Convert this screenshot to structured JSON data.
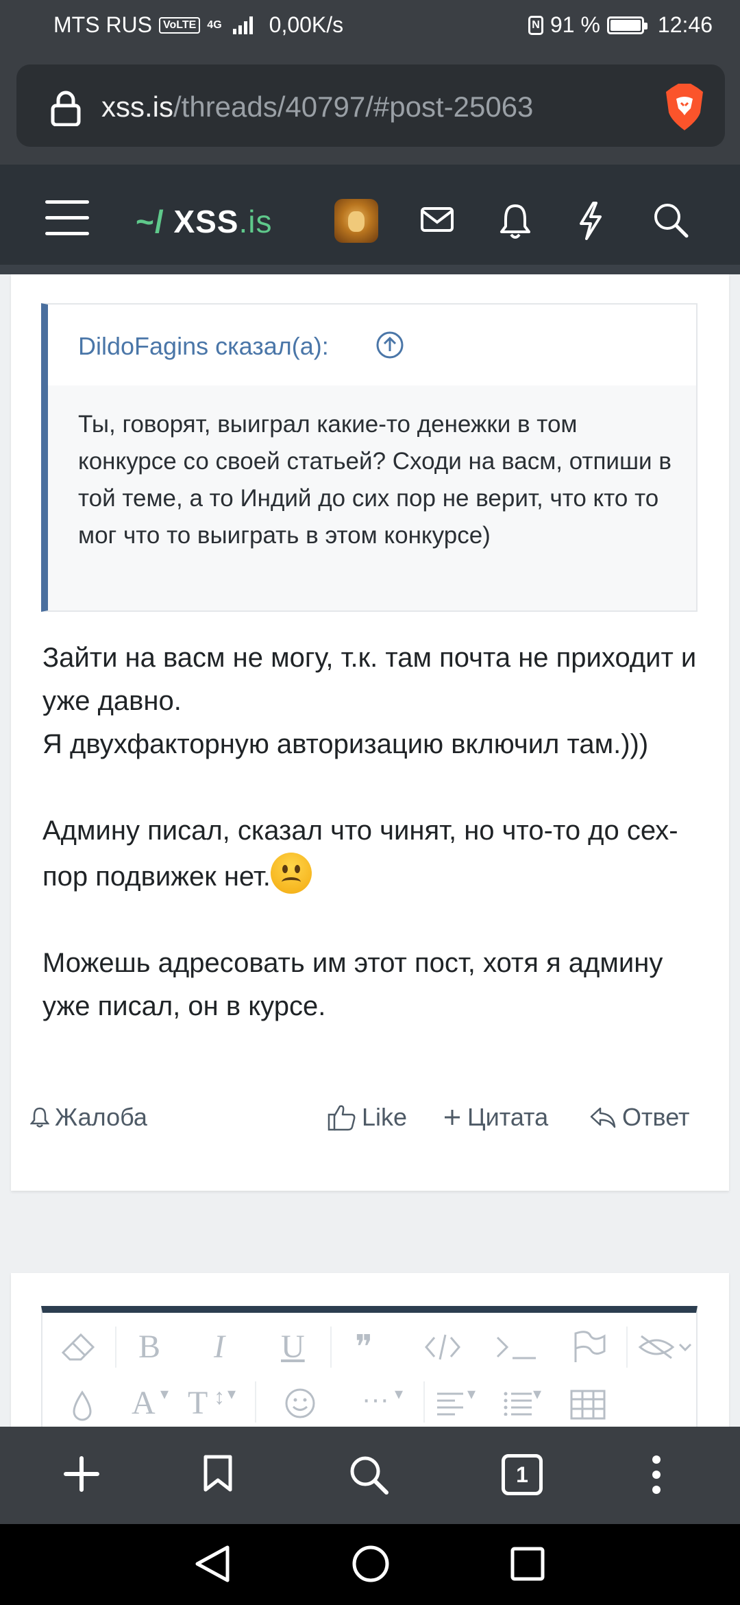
{
  "status_bar": {
    "carrier": "MTS RUS",
    "volte": "VoLTE",
    "network": "4G",
    "speed": "0,00K/s",
    "battery": "91 %",
    "time": "12:46"
  },
  "browser": {
    "url_host": "xss.is",
    "url_path": "/threads/40797/#post-25063",
    "tab_count": "1"
  },
  "site": {
    "logo_tilde": "~/",
    "logo_main": "XSS",
    "logo_tld": ".is"
  },
  "post": {
    "quote_author": "DildoFagins сказал(а):",
    "quote_text": "Ты, говорят, выиграл какие-то денежки в том конкурсе со своей статьей? Сходи на васм, отпиши в той теме, а то Индий до сих пор не верит, что кто то мог что то выиграть в этом конкурсе)",
    "paragraph1_line1": "Зайти на васм не могу, т.к. там почта не приходит и уже давно.",
    "paragraph1_line2": "Я двухфакторную авторизацию включил там.)))",
    "paragraph2": "Админу писал, сказал что чинят, но что-то до сех-пор подвижек нет.",
    "paragraph3": "Можешь адресовать им этот пост, хотя я админу уже писал, он в курсе."
  },
  "actions": {
    "report": "Жалоба",
    "like": "Like",
    "quote": "Цитата",
    "reply": "Ответ"
  },
  "colors": {
    "header_bg": "#2c3238",
    "logo_green": "#5fc98b",
    "quote_border": "#4a6f9e",
    "link_blue": "#4a76a8"
  }
}
